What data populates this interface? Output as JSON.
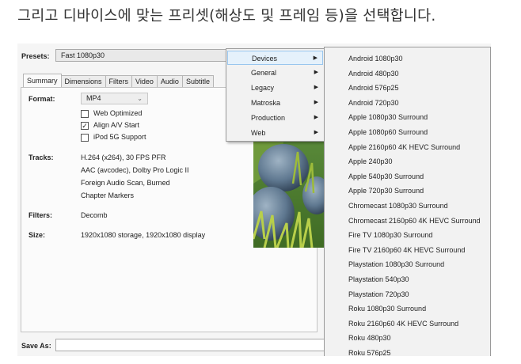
{
  "caption": "그리고 디바이스에 맞는 프리셋(해상도 및 프레임 등)을 선택합니다.",
  "presets": {
    "label": "Presets:",
    "value": "Fast 1080p30"
  },
  "tabs": [
    "Summary",
    "Dimensions",
    "Filters",
    "Video",
    "Audio",
    "Subtitle"
  ],
  "summary": {
    "format_label": "Format:",
    "format_value": "MP4",
    "web_optimized": {
      "label": "Web Optimized",
      "checked": false
    },
    "align_av": {
      "label": "Align A/V Start",
      "checked": true
    },
    "ipod": {
      "label": "iPod 5G Support",
      "checked": false
    },
    "tracks_label": "Tracks:",
    "tracks": [
      "H.264 (x264), 30 FPS PFR",
      "AAC (avcodec), Dolby Pro Logic II",
      "Foreign Audio Scan, Burned",
      "Chapter Markers"
    ],
    "filters_label": "Filters:",
    "filters_value": "Decomb",
    "size_label": "Size:",
    "size_value": "1920x1080 storage, 1920x1080 display"
  },
  "save_as_label": "Save As:",
  "menu_categories": [
    "Devices",
    "General",
    "Legacy",
    "Matroska",
    "Production",
    "Web"
  ],
  "menu_selected": "Devices",
  "device_presets": [
    "Android 1080p30",
    "Android 480p30",
    "Android 576p25",
    "Android 720p30",
    "Apple 1080p30 Surround",
    "Apple 1080p60 Surround",
    "Apple 2160p60 4K HEVC Surround",
    "Apple 240p30",
    "Apple 540p30 Surround",
    "Apple 720p30 Surround",
    "Chromecast 1080p30 Surround",
    "Chromecast 2160p60 4K HEVC Surround",
    "Fire TV 1080p30 Surround",
    "Fire TV 2160p60 4K HEVC Surround",
    "Playstation 1080p30 Surround",
    "Playstation 540p30",
    "Playstation 720p30",
    "Roku 1080p30 Surround",
    "Roku 2160p60 4K HEVC Surround",
    "Roku 480p30",
    "Roku 576p25"
  ],
  "icons": {
    "submenu_arrow": "chevron-right-icon",
    "dropdown_arrow": "chevron-down-icon",
    "check": "checkmark-icon"
  },
  "colors": {
    "menu_highlight": "#e5f1fb",
    "menu_highlight_border": "#99c6ee"
  }
}
